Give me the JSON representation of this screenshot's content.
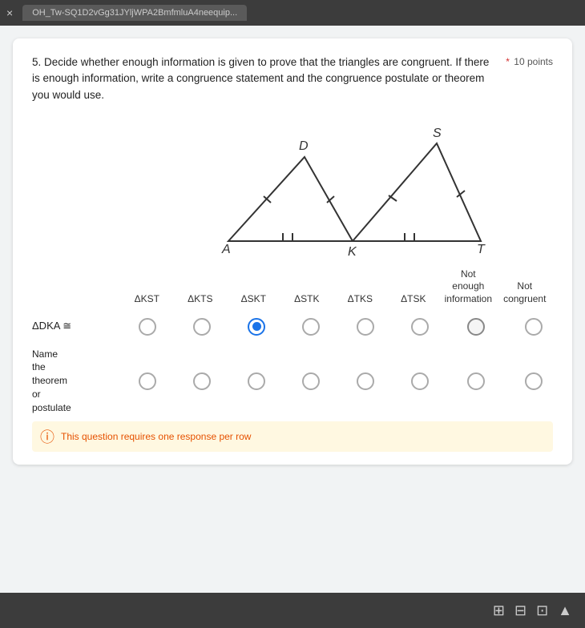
{
  "browser": {
    "tab_text": "OH_Tw-SQ1D2vGg31JYljWPA2BmfmluA4neequip...",
    "close_label": "×"
  },
  "question": {
    "number": "5.",
    "body": "Decide whether enough information is given to prove that the triangles are congruent. If there is enough information, write a congruence statement and the congruence postulate or theorem you would use.",
    "points_label": "10 points",
    "required_star": "*"
  },
  "columns": {
    "options": [
      "ΔKST",
      "ΔKTS",
      "ΔSKT",
      "ΔSTK",
      "ΔTKS",
      "ΔTSK"
    ],
    "not_enough": "Not\nenough\ninformation",
    "not_congruent": "Not\ncongruent"
  },
  "rows": [
    {
      "label": "ΔDKA ≅",
      "selected_index": 2,
      "id": "row-dka"
    },
    {
      "label": "Name\nthe\ntheorem\nor\npostulate",
      "selected_index": -1,
      "id": "row-theorem"
    }
  ],
  "warning": {
    "text": "This question requires one response per row"
  },
  "icons": {
    "close": "✕",
    "warning": "ⓘ",
    "grid": "⊞",
    "excel": "⊟",
    "powerpoint": "⊡",
    "back": "▲"
  }
}
